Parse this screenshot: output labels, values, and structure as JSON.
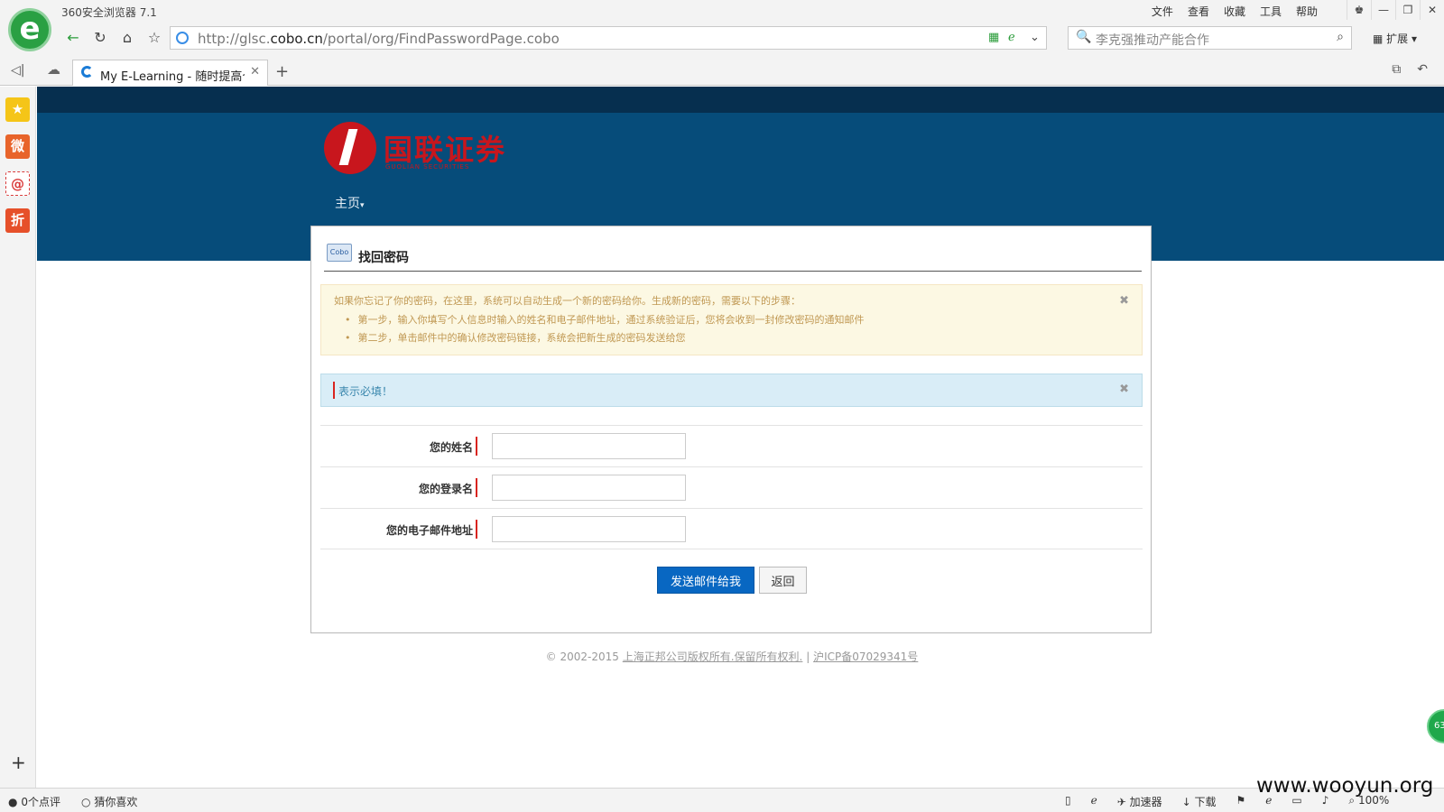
{
  "browser": {
    "app_title": "360安全浏览器 7.1",
    "menus": [
      "文件",
      "查看",
      "收藏",
      "工具",
      "帮助"
    ],
    "url_prefix": "http://glsc.",
    "url_domain": "cobo.cn",
    "url_path": "/portal/org/FindPasswordPage.cobo",
    "search_text": "李克强推动产能合作",
    "extensions_label": "扩展",
    "tab_title": "My E-Learning - 随时提高个人",
    "sidebar_items": [
      {
        "label": "★",
        "color": "#f5c518"
      },
      {
        "label": "微",
        "color": "#e8642b"
      },
      {
        "label": "@",
        "color": "#d93a3a"
      },
      {
        "label": "折",
        "color": "#e6502a"
      }
    ],
    "status_left_1": "0个点评",
    "status_left_2": "猜你喜欢",
    "status_accelerator": "加速器",
    "status_download": "下载",
    "status_zoom": "100%",
    "watermark": "www.wooyun.org",
    "float_ball": "63"
  },
  "site": {
    "brand_name": "国联证券",
    "brand_sub": "GUOLIAN SECURITIES",
    "nav_home": "主页"
  },
  "card": {
    "title": "找回密码",
    "icon_label": "Cobo",
    "intro": "如果你忘记了你的密码，在这里，系统可以自动生成一个新的密码给你。生成新的密码，需要以下的步骤：",
    "steps": [
      "第一步，输入你填写个人信息时输入的姓名和电子邮件地址，通过系统验证后，您将会收到一封修改密码的通知邮件",
      "第二步，单击邮件中的确认修改密码链接，系统会把新生成的密码发送给您"
    ],
    "required_note": "表示必填！",
    "fields": [
      {
        "label": "您的姓名",
        "value": ""
      },
      {
        "label": "您的登录名",
        "value": ""
      },
      {
        "label": "您的电子邮件地址",
        "value": ""
      }
    ],
    "send_button": "发送邮件给我",
    "back_button": "返回"
  },
  "footer": {
    "copyright": "© 2002-2015",
    "company_link": "上海正邦公司版权所有.保留所有权利.",
    "separator": "|",
    "icp_link": "沪ICP备07029341号"
  },
  "colors": {
    "header_bg": "#064c7a",
    "top_strip": "#062f4f",
    "brand_red": "#c8161d",
    "primary_button": "#0867c2"
  }
}
